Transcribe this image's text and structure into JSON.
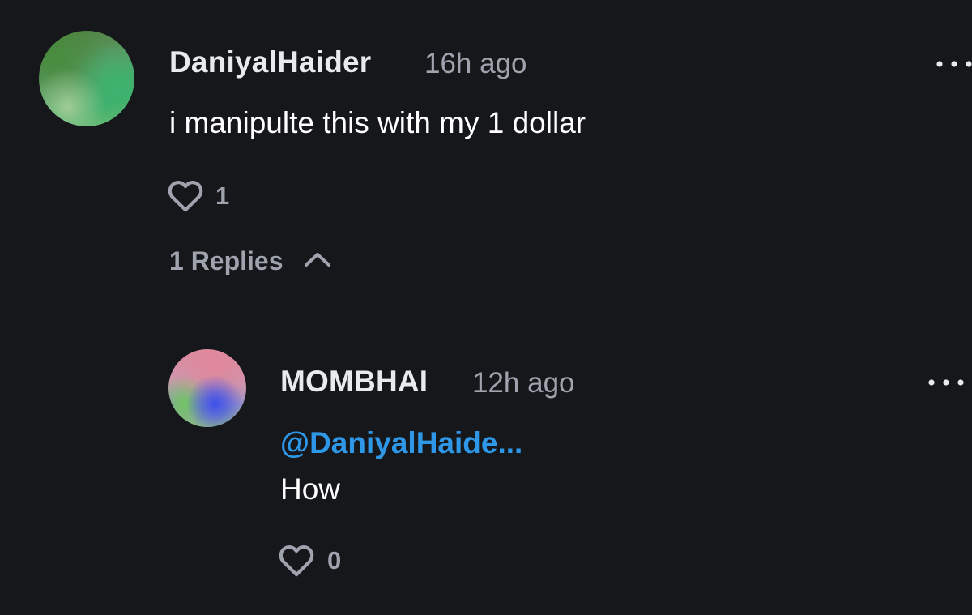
{
  "comment": {
    "username": "DaniyalHaider",
    "time": "16h ago",
    "text": "i manipulte this with my 1 dollar",
    "likes": "1",
    "replies_label": "1 Replies"
  },
  "reply": {
    "username": "MOMBHAI",
    "time": "12h ago",
    "mention": "@DaniyalHaide...",
    "text": "How",
    "likes": "0"
  },
  "colors": {
    "background": "#15171b",
    "mention": "#2f97e8",
    "muted": "#9ea3ad"
  },
  "icons": {
    "like": "heart-icon",
    "more": "more-options-icon",
    "collapse": "chevron-up-icon"
  }
}
